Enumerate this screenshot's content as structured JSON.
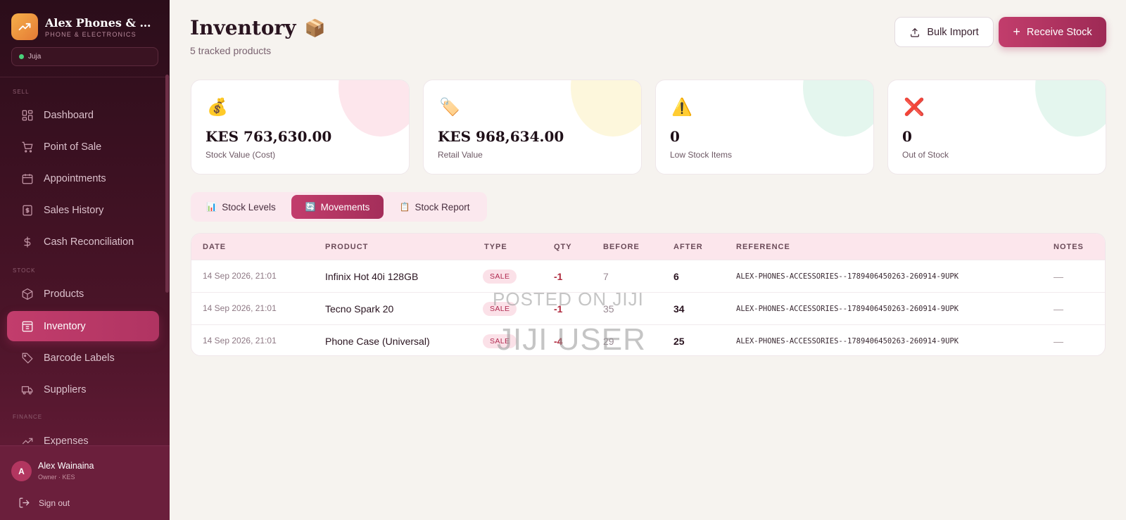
{
  "brand": {
    "name": "Alex Phones & Acce...",
    "subtitle": "PHONE & ELECTRONICS",
    "branch": "Juja"
  },
  "sidebar": {
    "sections": {
      "sell": "SELL",
      "stock": "STOCK",
      "finance": "FINANCE"
    },
    "items": [
      {
        "label": "Dashboard",
        "icon": "dashboard-icon"
      },
      {
        "label": "Point of Sale",
        "icon": "cart-icon"
      },
      {
        "label": "Appointments",
        "icon": "calendar-icon"
      },
      {
        "label": "Sales History",
        "icon": "receipt-icon"
      },
      {
        "label": "Cash Reconciliation",
        "icon": "dollar-icon"
      },
      {
        "label": "Products",
        "icon": "box-icon"
      },
      {
        "label": "Inventory",
        "icon": "inventory-icon",
        "active": true
      },
      {
        "label": "Barcode Labels",
        "icon": "tag-icon"
      },
      {
        "label": "Suppliers",
        "icon": "truck-icon"
      },
      {
        "label": "Expenses",
        "icon": "trend-icon"
      }
    ],
    "user": {
      "initial": "A",
      "name": "Alex Wainaina",
      "role": "Owner · KES"
    },
    "signout": "Sign out"
  },
  "header": {
    "title": "Inventory",
    "title_emoji": "📦",
    "subtitle": "5 tracked products"
  },
  "actions": {
    "bulk_import": "Bulk Import",
    "receive_stock": "Receive Stock"
  },
  "stats": [
    {
      "icon": "💰",
      "value": "KES 763,630.00",
      "label": "Stock Value (Cost)",
      "blob_color": "#fde6ec"
    },
    {
      "icon": "🏷️",
      "value": "KES 968,634.00",
      "label": "Retail Value",
      "blob_color": "#fdf7dc"
    },
    {
      "icon": "⚠️",
      "value": "0",
      "label": "Low Stock Items",
      "blob_color": "#e4f6ee"
    },
    {
      "icon": "❌",
      "value": "0",
      "label": "Out of Stock",
      "blob_color": "#e4f6ee"
    }
  ],
  "tabs": [
    {
      "icon": "📊",
      "label": "Stock Levels"
    },
    {
      "icon": "🔄",
      "label": "Movements",
      "active": true
    },
    {
      "icon": "📋",
      "label": "Stock Report"
    }
  ],
  "table": {
    "headers": {
      "date": "DATE",
      "product": "PRODUCT",
      "type": "TYPE",
      "qty": "QTY",
      "before": "BEFORE",
      "after": "AFTER",
      "reference": "REFERENCE",
      "notes": "NOTES"
    },
    "rows": [
      {
        "date": "14 Sep 2026, 21:01",
        "product": "Infinix Hot 40i 128GB",
        "type": "SALE",
        "qty": "-1",
        "before": "7",
        "after": "6",
        "reference": "ALEX-PHONES-ACCESSORIES--1789406450263-260914-9UPK",
        "notes": "—"
      },
      {
        "date": "14 Sep 2026, 21:01",
        "product": "Tecno Spark 20",
        "type": "SALE",
        "qty": "-1",
        "before": "35",
        "after": "34",
        "reference": "ALEX-PHONES-ACCESSORIES--1789406450263-260914-9UPK",
        "notes": "—"
      },
      {
        "date": "14 Sep 2026, 21:01",
        "product": "Phone Case (Universal)",
        "type": "SALE",
        "qty": "-4",
        "before": "29",
        "after": "25",
        "reference": "ALEX-PHONES-ACCESSORIES--1789406450263-260914-9UPK",
        "notes": "—"
      }
    ]
  },
  "watermark": {
    "line1": "POSTED ON JIJI",
    "line2": "JIJI USER"
  }
}
